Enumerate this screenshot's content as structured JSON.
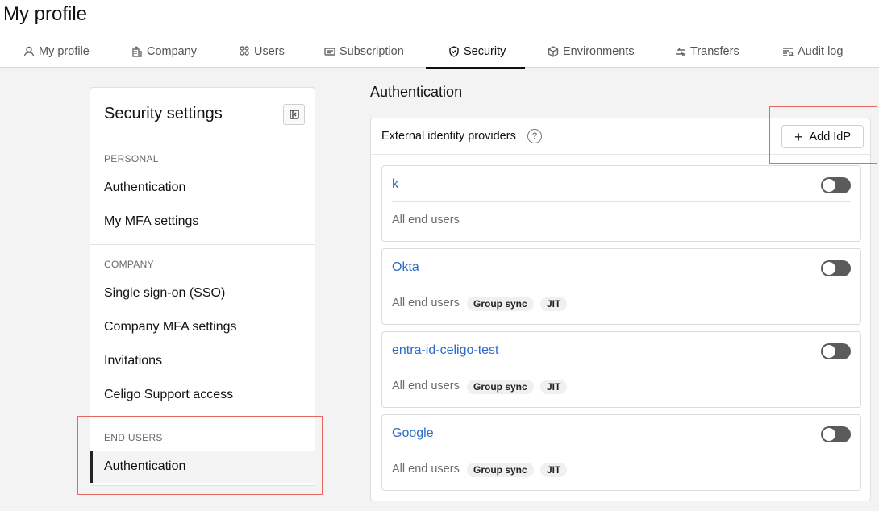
{
  "page": {
    "title": "My profile"
  },
  "tabs": [
    {
      "label": "My profile",
      "icon": "user-icon"
    },
    {
      "label": "Company",
      "icon": "building-icon"
    },
    {
      "label": "Users",
      "icon": "users-icon"
    },
    {
      "label": "Subscription",
      "icon": "card-icon"
    },
    {
      "label": "Security",
      "icon": "shield-icon",
      "active": true
    },
    {
      "label": "Environments",
      "icon": "cube-icon"
    },
    {
      "label": "Transfers",
      "icon": "transfer-icon"
    },
    {
      "label": "Audit log",
      "icon": "audit-log-icon"
    }
  ],
  "sidebar": {
    "title": "Security settings",
    "sections": [
      {
        "heading": "PERSONAL",
        "items": [
          "Authentication",
          "My MFA settings"
        ]
      },
      {
        "heading": "COMPANY",
        "items": [
          "Single sign-on (SSO)",
          "Company MFA settings",
          "Invitations",
          "Celigo Support access"
        ]
      },
      {
        "heading": "END USERS",
        "items": [
          "Authentication"
        ],
        "active_item": "Authentication"
      }
    ]
  },
  "main": {
    "title": "Authentication",
    "providers_header": "External identity providers",
    "help_glyph": "?",
    "add_button": "Add IdP",
    "providers": [
      {
        "name": "k",
        "scope": "All end users",
        "badges": [],
        "enabled": false
      },
      {
        "name": "Okta",
        "scope": "All end users",
        "badges": [
          "Group sync",
          "JIT"
        ],
        "enabled": false
      },
      {
        "name": "entra-id-celigo-test",
        "scope": "All end users",
        "badges": [
          "Group sync",
          "JIT"
        ],
        "enabled": false
      },
      {
        "name": "Google",
        "scope": "All end users",
        "badges": [
          "Group sync",
          "JIT"
        ],
        "enabled": false
      }
    ]
  },
  "colors": {
    "link": "#2a6bc9",
    "highlight": "#e5675d",
    "toggle_off": "#5b5b5b"
  }
}
